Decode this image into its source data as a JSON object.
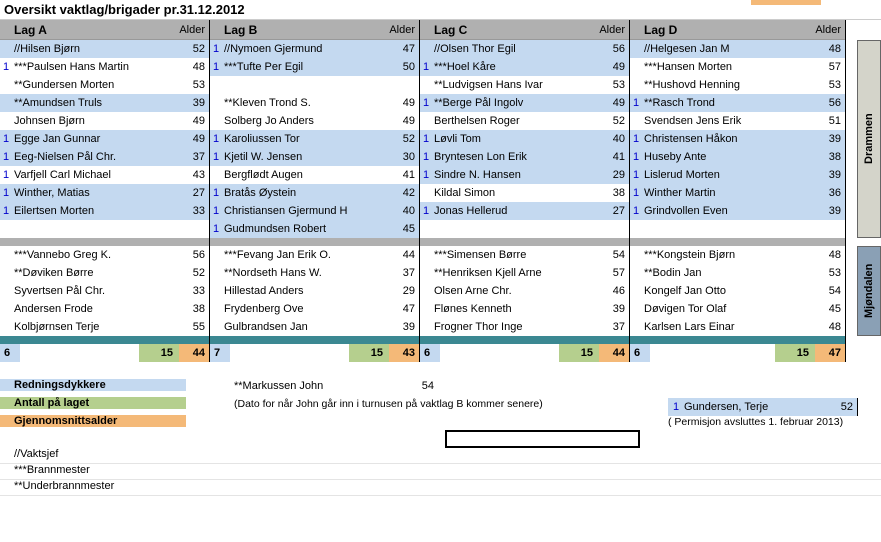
{
  "title": "Oversikt vaktlag/brigader pr.31.12.2012",
  "header_age": "Alder",
  "side_labels": {
    "drammen": "Drammen",
    "mjondalen": "Mjøndalen"
  },
  "teams": [
    {
      "name": "Lag A",
      "top": [
        {
          "m": "",
          "name": "//Hilsen Bjørn",
          "age": 52,
          "hl": true
        },
        {
          "m": "1",
          "name": "***Paulsen Hans Martin",
          "age": 48,
          "hl": false
        },
        {
          "m": "",
          "name": "**Gundersen Morten",
          "age": 53,
          "hl": false
        },
        {
          "m": "",
          "name": "**Amundsen Truls",
          "age": 39,
          "hl": true
        },
        {
          "m": "",
          "name": "Johnsen Bjørn",
          "age": 49,
          "hl": false
        },
        {
          "m": "1",
          "name": "Egge Jan Gunnar",
          "age": 49,
          "hl": true
        },
        {
          "m": "1",
          "name": "Eeg-Nielsen Pål Chr.",
          "age": 37,
          "hl": true
        },
        {
          "m": "1",
          "name": "Varfjell Carl Michael",
          "age": 43,
          "hl": false
        },
        {
          "m": "1",
          "name": "Winther, Matias",
          "age": 27,
          "hl": true
        },
        {
          "m": "1",
          "name": "Eilertsen Morten",
          "age": 33,
          "hl": true
        }
      ],
      "bottom": [
        {
          "m": "",
          "name": "***Vannebo Greg K.",
          "age": 56
        },
        {
          "m": "",
          "name": "**Døviken Børre",
          "age": 52
        },
        {
          "m": "",
          "name": "Syvertsen Pål Chr.",
          "age": 33
        },
        {
          "m": "",
          "name": "Andersen Frode",
          "age": 38
        },
        {
          "m": "",
          "name": "Kolbjørnsen Terje",
          "age": 55
        }
      ],
      "summary": {
        "count": 6,
        "total": 15,
        "avg": 44
      }
    },
    {
      "name": "Lag B",
      "top": [
        {
          "m": "1",
          "name": "//Nymoen Gjermund",
          "age": 47,
          "hl": true
        },
        {
          "m": "1",
          "name": "***Tufte Per Egil",
          "age": 50,
          "hl": true
        },
        {
          "m": "",
          "name": "",
          "age": "",
          "hl": false
        },
        {
          "m": "",
          "name": "**Kleven Trond S.",
          "age": 49,
          "hl": false
        },
        {
          "m": "",
          "name": "Solberg Jo Anders",
          "age": 49,
          "hl": false
        },
        {
          "m": "1",
          "name": "Karoliussen Tor",
          "age": 52,
          "hl": true
        },
        {
          "m": "1",
          "name": "Kjetil W. Jensen",
          "age": 30,
          "hl": true
        },
        {
          "m": "",
          "name": "Bergflødt Augen",
          "age": 41,
          "hl": false
        },
        {
          "m": "1",
          "name": "Bratås Øystein",
          "age": 42,
          "hl": true
        },
        {
          "m": "1",
          "name": "Christiansen Gjermund H",
          "age": 40,
          "hl": true
        },
        {
          "m": "1",
          "name": "Gudmundsen Robert",
          "age": 45,
          "hl": true
        }
      ],
      "bottom": [
        {
          "m": "",
          "name": "***Fevang Jan Erik O.",
          "age": 44
        },
        {
          "m": "",
          "name": "**Nordseth Hans W.",
          "age": 37
        },
        {
          "m": "",
          "name": "Hillestad Anders",
          "age": 29
        },
        {
          "m": "",
          "name": "Frydenberg Ove",
          "age": 47
        },
        {
          "m": "",
          "name": "Gulbrandsen Jan",
          "age": 39
        }
      ],
      "summary": {
        "count": 7,
        "total": 15,
        "avg": 43
      }
    },
    {
      "name": "Lag C",
      "top": [
        {
          "m": "",
          "name": "//Olsen Thor Egil",
          "age": 56,
          "hl": true
        },
        {
          "m": "1",
          "name": "***Hoel Kåre",
          "age": 49,
          "hl": true
        },
        {
          "m": "",
          "name": "**Ludvigsen Hans Ivar",
          "age": 53,
          "hl": false
        },
        {
          "m": "1",
          "name": "**Berge Pål Ingolv",
          "age": 49,
          "hl": true
        },
        {
          "m": "",
          "name": "Berthelsen Roger",
          "age": 52,
          "hl": false
        },
        {
          "m": "1",
          "name": "Løvli Tom",
          "age": 40,
          "hl": true
        },
        {
          "m": "1",
          "name": "Bryntesen Lon Erik",
          "age": 41,
          "hl": true
        },
        {
          "m": "1",
          "name": "Sindre N. Hansen",
          "age": 29,
          "hl": true
        },
        {
          "m": "",
          "name": "Kildal Simon",
          "age": 38,
          "hl": false
        },
        {
          "m": "1",
          "name": "Jonas Hellerud",
          "age": 27,
          "hl": true
        }
      ],
      "bottom": [
        {
          "m": "",
          "name": "***Simensen Børre",
          "age": 54
        },
        {
          "m": "",
          "name": "**Henriksen Kjell Arne",
          "age": 57
        },
        {
          "m": "",
          "name": "Olsen Arne Chr.",
          "age": 46
        },
        {
          "m": "",
          "name": "Flønes Kenneth",
          "age": 39
        },
        {
          "m": "",
          "name": "Frogner Thor Inge",
          "age": 37
        }
      ],
      "summary": {
        "count": 6,
        "total": 15,
        "avg": 44
      }
    },
    {
      "name": "Lag D",
      "top": [
        {
          "m": "",
          "name": "//Helgesen Jan M",
          "age": 48,
          "hl": true
        },
        {
          "m": "",
          "name": "***Hansen Morten",
          "age": 57,
          "hl": false
        },
        {
          "m": "",
          "name": "**Hushovd Henning",
          "age": 53,
          "hl": false
        },
        {
          "m": "1",
          "name": "**Rasch Trond",
          "age": 56,
          "hl": true
        },
        {
          "m": "",
          "name": "Svendsen Jens Erik",
          "age": 51,
          "hl": false
        },
        {
          "m": "1",
          "name": "Christensen Håkon",
          "age": 39,
          "hl": true
        },
        {
          "m": "1",
          "name": "Huseby Ante",
          "age": 38,
          "hl": true
        },
        {
          "m": "1",
          "name": "Lislerud Morten",
          "age": 39,
          "hl": true
        },
        {
          "m": "1",
          "name": "Winther Martin",
          "age": 36,
          "hl": true
        },
        {
          "m": "1",
          "name": "Grindvollen Even",
          "age": 39,
          "hl": true
        }
      ],
      "bottom": [
        {
          "m": "",
          "name": "***Kongstein Bjørn",
          "age": 48
        },
        {
          "m": "",
          "name": "**Bodin Jan",
          "age": 53
        },
        {
          "m": "",
          "name": "Kongelf Jan Otto",
          "age": 54
        },
        {
          "m": "",
          "name": "Døvigen Tor Olaf",
          "age": 45
        },
        {
          "m": "",
          "name": "Karlsen Lars Einar",
          "age": 48
        }
      ],
      "summary": {
        "count": 6,
        "total": 15,
        "avg": 47
      }
    }
  ],
  "legend": {
    "redning": "Redningsdykkere",
    "antall": "Antall på laget",
    "gjennom": "Gjennomsnittsalder"
  },
  "extra": {
    "markussen_name": "**Markussen John",
    "markussen_age": 54,
    "dato_note": "(Dato for når John går inn i turnusen på vaktlag B kommer senere)",
    "gundersen_marker": "1",
    "gundersen_name": "Gundersen, Terje",
    "gundersen_age": 52,
    "perm_note": "( Permisjon avsluttes 1. februar 2013)"
  },
  "notes": {
    "n1": "//Vaktsjef",
    "n2": "***Brannmester",
    "n3": "**Underbrannmester"
  }
}
